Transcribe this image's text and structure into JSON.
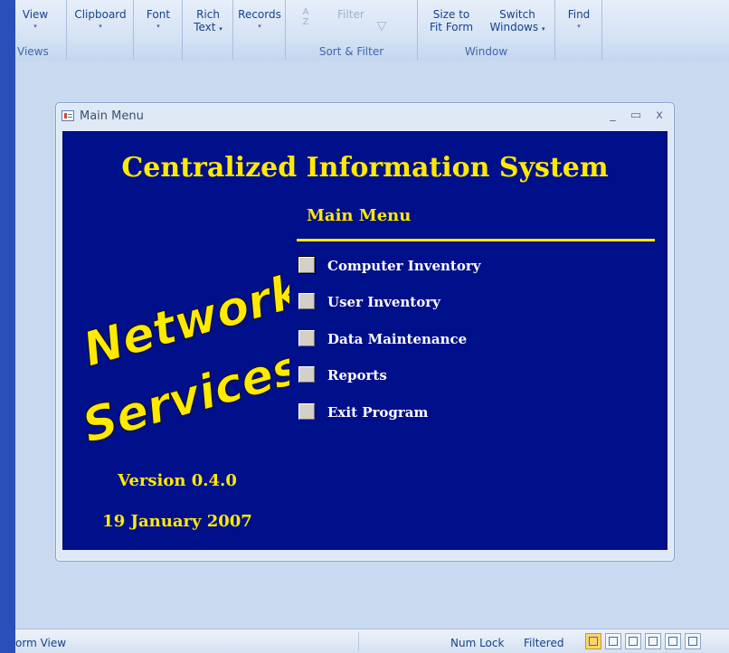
{
  "ribbon": {
    "views": {
      "label": "View",
      "group_label": "Views"
    },
    "clipboard": {
      "label": "Clipboard"
    },
    "font": {
      "label": "Font"
    },
    "rich_text": {
      "label_line1": "Rich",
      "label_line2": "Text"
    },
    "records": {
      "label": "Records"
    },
    "sort_filter": {
      "filter_label": "Filter",
      "group_label": "Sort & Filter"
    },
    "window": {
      "size_to_fit_line1": "Size to",
      "size_to_fit_line2": "Fit Form",
      "switch_line1": "Switch",
      "switch_line2": "Windows",
      "group_label": "Window"
    },
    "find": {
      "label": "Find"
    },
    "dropdown_caret": "▾"
  },
  "form_window": {
    "title": "Main Menu",
    "controls": {
      "minimize": "_",
      "maximize": "▭",
      "close": "x"
    }
  },
  "form": {
    "title": "Centralized Information System",
    "menu_heading": "Main Menu",
    "logo": {
      "line1": "Network",
      "line2": "Services"
    },
    "menu_items": [
      {
        "label": "Computer Inventory"
      },
      {
        "label": "User Inventory"
      },
      {
        "label": "Data Maintenance"
      },
      {
        "label": "Reports"
      },
      {
        "label": "Exit Program"
      }
    ],
    "version": "Version 0.4.0",
    "date": "19 January 2007"
  },
  "statusbar": {
    "left_text": "orm View",
    "num_lock": "Num Lock",
    "filtered": "Filtered"
  },
  "colors": {
    "form_background": "#00108a",
    "accent_yellow": "#ffea00",
    "menu_text": "#ffffff"
  }
}
